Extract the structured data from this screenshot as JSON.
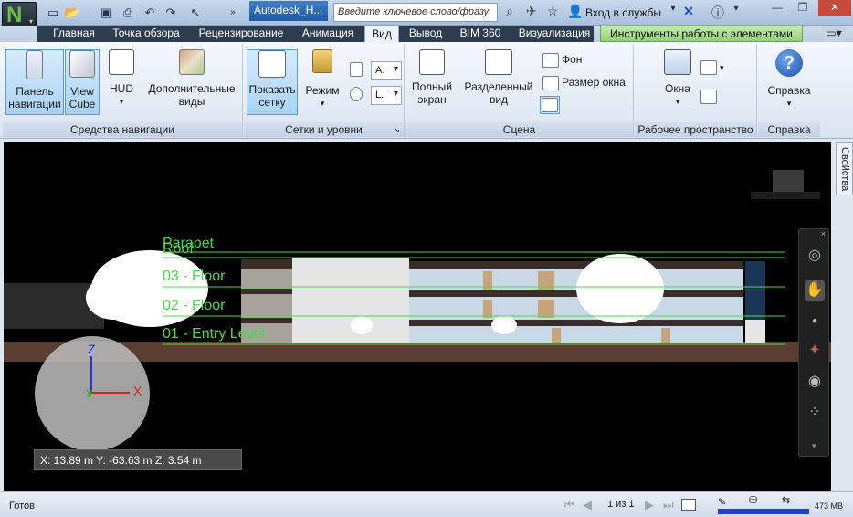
{
  "titlebar": {
    "document_title": "Autodesk_H...",
    "search_placeholder": "Введите ключевое слово/фразу",
    "signin_label": "Вход в службы"
  },
  "tabs": [
    {
      "label": "Главная"
    },
    {
      "label": "Точка обзора"
    },
    {
      "label": "Рецензирование"
    },
    {
      "label": "Анимация"
    },
    {
      "label": "Вид",
      "active": true
    },
    {
      "label": "Вывод"
    },
    {
      "label": "BIM 360"
    },
    {
      "label": "Визуализация"
    },
    {
      "label": "Инструменты работы с элементами",
      "contextual": true
    }
  ],
  "ribbon": {
    "nav_panel": {
      "title": "Средства навигации",
      "nav_panel_btn": "Панель навигации",
      "viewcube_btn": "View Cube",
      "hud_btn": "HUD",
      "extra_views_btn": "Дополнительные виды"
    },
    "grid_panel": {
      "title": "Сетки и уровни",
      "show_grid_btn": "Показать сетку",
      "mode_btn": "Режим",
      "dd1_value": "A.",
      "dd2_value": "L."
    },
    "scene_panel": {
      "title": "Сцена",
      "fullscreen_btn": "Полный экран",
      "split_view_btn": "Разделенный вид",
      "background_btn": "Фон",
      "window_size_btn": "Размер окна"
    },
    "workspace_panel": {
      "title": "Рабочее пространство",
      "windows_btn": "Окна"
    },
    "help_panel": {
      "title": "Справка",
      "help_btn": "Справка"
    }
  },
  "viewport": {
    "properties_tab": "Свойства",
    "levels": [
      "Parapet",
      "Roof",
      "03 - Floor",
      "02 - Floor",
      "01 - Entry Level"
    ],
    "axis_labels": {
      "z": "Z",
      "x": "X",
      "y": "Y"
    },
    "coords": "X: 13.89 m  Y: -63.63 m  Z: 3.54 m"
  },
  "statusbar": {
    "status": "Готов",
    "page": "1 из 1",
    "memory": "473 MB"
  },
  "colors": {
    "level_line": "#44dd44",
    "ground": "#5a3e32",
    "accent": "#2b6cb5"
  }
}
